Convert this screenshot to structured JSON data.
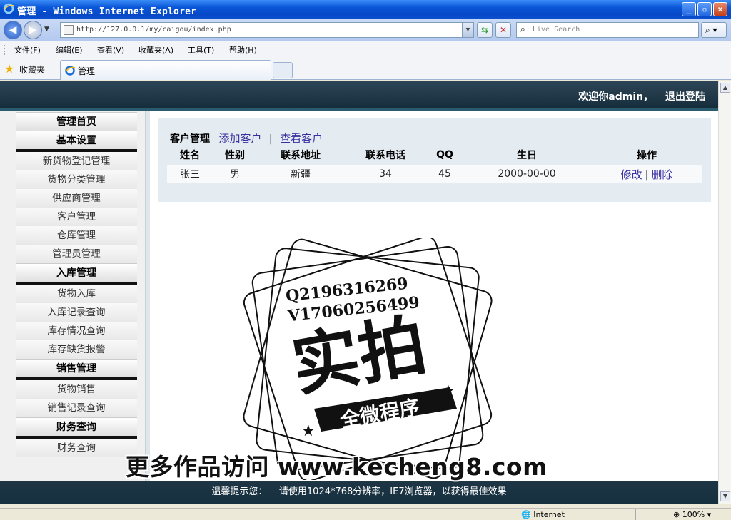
{
  "window": {
    "title": "管理 - Windows Internet Explorer",
    "minimize": "_",
    "maximize": "▫",
    "close": "×"
  },
  "address_bar": {
    "url": "http://127.0.0.1/my/caigou/index.php",
    "search_placeholder": "Live Search"
  },
  "menu_bar": [
    "文件(F)",
    "编辑(E)",
    "查看(V)",
    "收藏夹(A)",
    "工具(T)",
    "帮助(H)"
  ],
  "tab_bar": {
    "favorites_label": "收藏夹",
    "tab_label": "管理"
  },
  "header": {
    "welcome": "欢迎你admin，",
    "logout": "退出登陆"
  },
  "sidebar": {
    "home": "管理首页",
    "groups": [
      {
        "title": "基本设置",
        "items": [
          "新货物登记管理",
          "货物分类管理",
          "供应商管理",
          "客户管理",
          "仓库管理",
          "管理员管理"
        ]
      },
      {
        "title": "入库管理",
        "items": [
          "货物入库",
          "入库记录查询",
          "库存情况查询",
          "库存缺货报警"
        ]
      },
      {
        "title": "销售管理",
        "items": [
          "货物销售",
          "销售记录查询"
        ]
      },
      {
        "title": "财务查询",
        "items": [
          "财务查询"
        ]
      }
    ]
  },
  "content": {
    "current": "客户管理",
    "add_link": "添加客户",
    "separator": "|",
    "view_link": "查看客户",
    "columns": [
      "姓名",
      "性别",
      "联系地址",
      "联系电话",
      "QQ",
      "生日",
      "操作"
    ],
    "rows": [
      {
        "name": "张三",
        "gender": "男",
        "address": "新疆",
        "phone": "34",
        "qq": "45",
        "birthday": "2000-00-00",
        "edit": "修改",
        "delete": "删除"
      }
    ]
  },
  "footer": {
    "notice": "温馨提示您：    请使用1024*768分辨率，IE7浏览器，以获得最佳效果"
  },
  "watermark": {
    "line1": "Q2196316269",
    "line2": "V17060256499",
    "big": "实拍",
    "banner": "全微程序",
    "promo": "更多作品访问 www.kecheng8.com"
  },
  "status_bar": {
    "zone": "Internet",
    "zoom": "100%"
  },
  "colors": {
    "header_bg": "#1e3544",
    "link": "#3a2f9e",
    "content_bg": "#e4ebf1"
  }
}
